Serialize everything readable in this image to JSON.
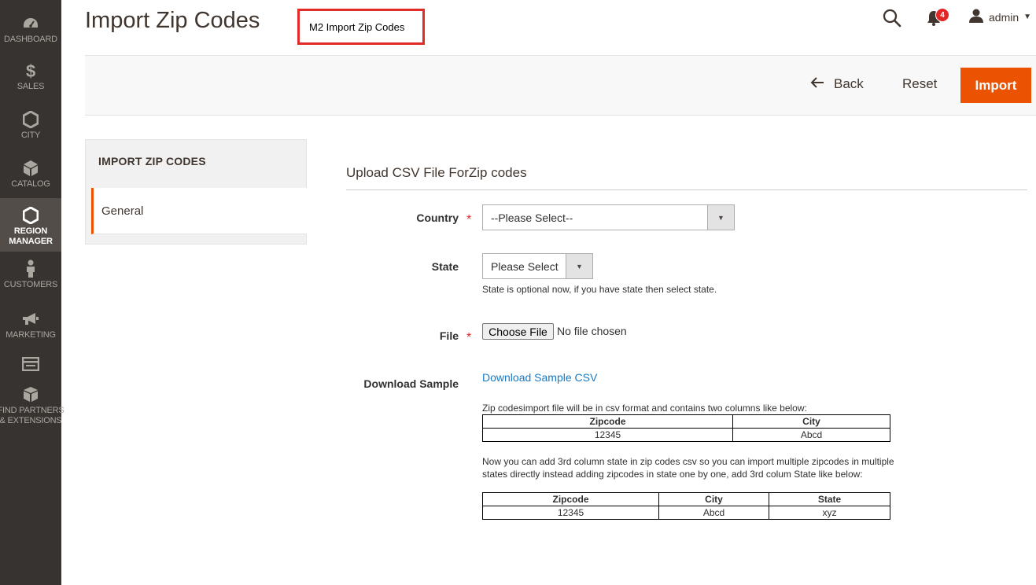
{
  "sidebar": {
    "items": [
      {
        "label": "DASHBOARD",
        "icon": "dashboard-icon"
      },
      {
        "label": "$",
        "sub": "SALES",
        "icon": "dollar-icon"
      },
      {
        "label": "CITY",
        "icon": "hexagon-icon"
      },
      {
        "label": "CATALOG",
        "icon": "cube-icon"
      },
      {
        "label": "REGION MANAGER",
        "icon": "hexagon-icon"
      },
      {
        "label": "CUSTOMERS",
        "icon": "person-icon"
      },
      {
        "label": "MARKETING",
        "icon": "megaphone-icon"
      },
      {
        "label": "",
        "icon": "store-icon"
      },
      {
        "label": "FIND PARTNERS & EXTENSIONS",
        "icon": "boxes-icon"
      }
    ],
    "labels": {
      "dashboard": "DASHBOARD",
      "sales": "SALES",
      "city": "CITY",
      "catalog": "CATALOG",
      "region_1": "REGION",
      "region_2": "MANAGER",
      "customers": "CUSTOMERS",
      "marketing": "MARKETING",
      "partners_1": "FIND PARTNERS",
      "partners_2": "& EXTENSIONS"
    },
    "active": "REGION MANAGER"
  },
  "header": {
    "title": "Import Zip Codes",
    "annotation": "M2 Import Zip Codes",
    "notification_count": "4",
    "user": "admin"
  },
  "actions": {
    "back": "Back",
    "reset": "Reset",
    "import": "Import"
  },
  "tabs": {
    "title": "IMPORT ZIP CODES",
    "items": [
      {
        "label": "General",
        "active": true
      }
    ]
  },
  "form": {
    "fieldset_title": "Upload CSV File ForZip codes",
    "country": {
      "label": "Country",
      "value": "--Please Select--",
      "required": true
    },
    "state": {
      "label": "State",
      "value": "Please Select",
      "note": "State is optional now, if you have state then select state."
    },
    "file": {
      "label": "File",
      "button": "Choose File",
      "status": "No file chosen",
      "required": true
    },
    "download": {
      "label": "Download Sample",
      "link": "Download Sample CSV"
    },
    "note1": "Zip codesimport file will be in csv format and contains two columns like below:",
    "table1": {
      "headers": [
        "Zipcode",
        "City"
      ],
      "rows": [
        [
          "12345",
          "Abcd"
        ]
      ]
    },
    "note2": "Now you can add 3rd column state in zip codes csv so you can import multiple zipcodes in multiple states directly instead adding zipcodes in state one by one, add 3rd colum State like below:",
    "table2": {
      "headers": [
        "Zipcode",
        "City",
        "State"
      ],
      "rows": [
        [
          "12345",
          "Abcd",
          "xyz"
        ]
      ]
    }
  },
  "colors": {
    "sidebar_bg": "#373330",
    "accent": "#eb5202",
    "link": "#1979c3",
    "required": "#e22626",
    "annotation_border": "#e02b27"
  }
}
